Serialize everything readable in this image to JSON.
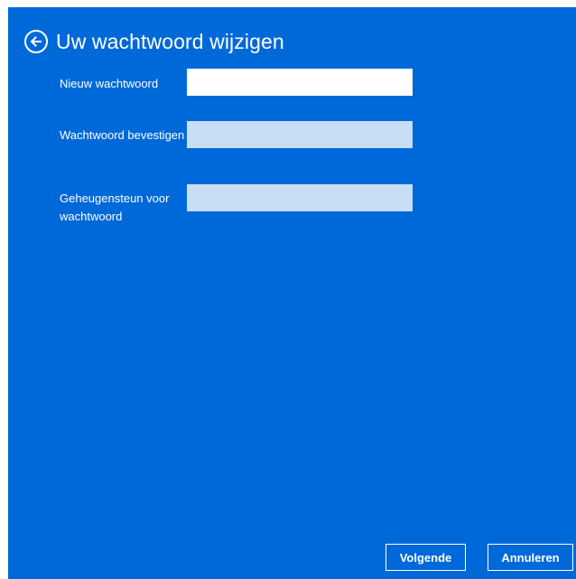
{
  "header": {
    "title": "Uw wachtwoord wijzigen",
    "back_icon": "back-arrow-circle-icon"
  },
  "form": {
    "new_password": {
      "label": "Nieuw wachtwoord",
      "value": ""
    },
    "confirm_password": {
      "label": "Wachtwoord bevestigen",
      "value": ""
    },
    "password_hint": {
      "label": "Geheugensteun voor wachtwoord",
      "value": ""
    }
  },
  "footer": {
    "next_label": "Volgende",
    "cancel_label": "Annuleren"
  },
  "colors": {
    "background": "#0069d9",
    "inactive_field": "#c9def4",
    "active_field": "#ffffff",
    "text": "#ffffff"
  }
}
